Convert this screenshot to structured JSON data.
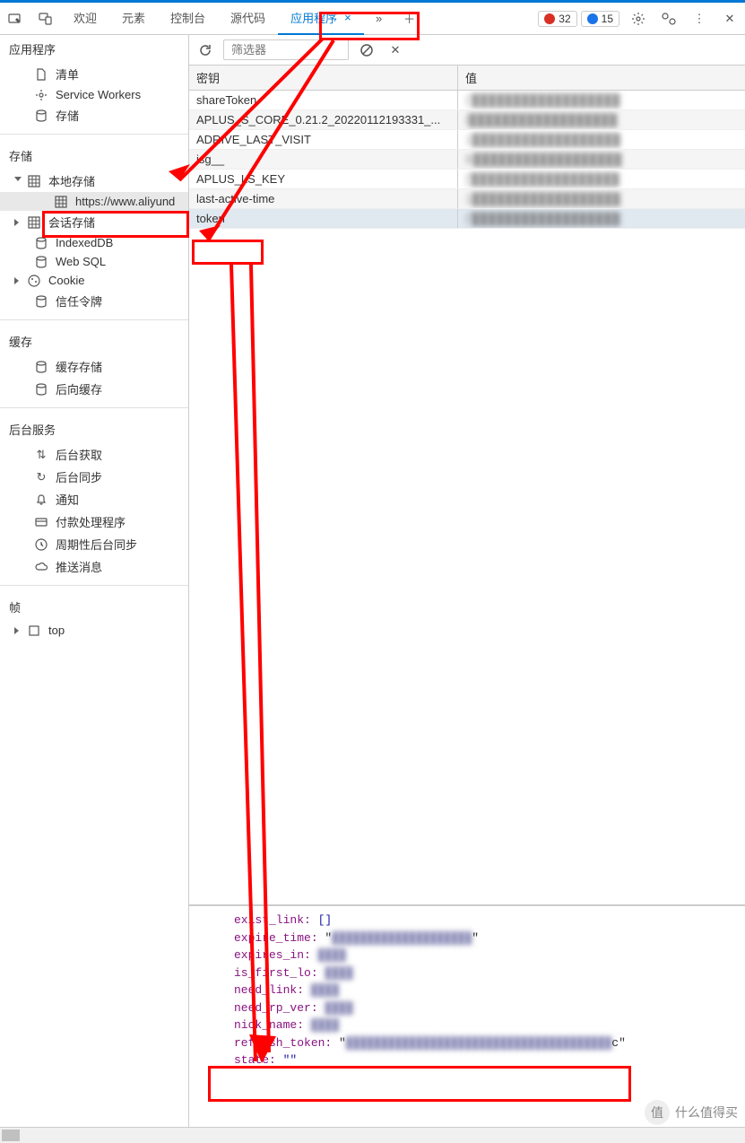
{
  "tabs": {
    "welcome": "欢迎",
    "elements": "元素",
    "console": "控制台",
    "sources": "源代码",
    "application": "应用程序"
  },
  "badges": {
    "errors": "32",
    "warnings": "15"
  },
  "sidebar": {
    "application_section": "应用程序",
    "manifest": "清单",
    "service_workers": "Service Workers",
    "storage_root": "存储",
    "storage_section": "存储",
    "local_storage": "本地存储",
    "local_storage_host": "https://www.aliyund",
    "session_storage": "会话存储",
    "indexeddb": "IndexedDB",
    "websql": "Web SQL",
    "cookie": "Cookie",
    "trust_tokens": "信任令牌",
    "cache_section": "缓存",
    "cache_storage": "缓存存储",
    "back_fwd_cache": "后向缓存",
    "bg_section": "后台服务",
    "bg_fetch": "后台获取",
    "bg_sync": "后台同步",
    "notifications": "通知",
    "payment": "付款处理程序",
    "periodic": "周期性后台同步",
    "push": "推送消息",
    "frames_section": "帧",
    "top_frame": "top"
  },
  "toolbar": {
    "filter_placeholder": "筛选器"
  },
  "table": {
    "header_key": "密钥",
    "header_value": "值",
    "rows": [
      {
        "key": "shareToken",
        "value": "{'"
      },
      {
        "key": "APLUS_S_CORE_0.21.2_20220112193331_...",
        "value": "/"
      },
      {
        "key": "ADRIVE_LAST_VISIT",
        "value": "1"
      },
      {
        "key": "isg__",
        "value": "B"
      },
      {
        "key": "APLUS_LS_KEY",
        "value": "['"
      },
      {
        "key": "last-active-time",
        "value": "1"
      },
      {
        "key": "token",
        "value": "{'"
      }
    ]
  },
  "detail": {
    "lines": [
      {
        "key": "exist_link",
        "val": "[]"
      },
      {
        "key": "expire_time",
        "val": "\"                     \""
      },
      {
        "key": "expires_in",
        "val": ""
      },
      {
        "key": "is_first_lo",
        "val": ""
      },
      {
        "key": "need_link",
        "val": ""
      },
      {
        "key": "need_rp_ver",
        "val": ""
      },
      {
        "key": "nick_name",
        "val": ""
      },
      {
        "key": "refresh_token",
        "val": "\"                                        c\""
      },
      {
        "key": "state",
        "val": "\"\""
      }
    ]
  },
  "watermark": "什么值得买"
}
